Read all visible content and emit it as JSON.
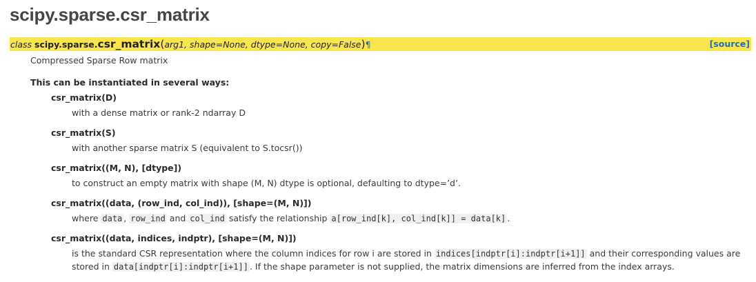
{
  "title": "scipy.sparse.csr_matrix",
  "signature": {
    "keyword": "class",
    "module": "scipy.sparse.",
    "name": "csr_matrix",
    "open": "(",
    "params": "arg1, shape=None, dtype=None, copy=False",
    "close": ")",
    "pilcrow": "¶",
    "source_link": "[source]"
  },
  "description": "Compressed Sparse Row matrix",
  "instantiation_heading": "This can be instantiated in several ways:",
  "ways": [
    {
      "term": "csr_matrix(D)",
      "text": "with a dense matrix or rank-2 ndarray D"
    },
    {
      "term": "csr_matrix(S)",
      "text": "with another sparse matrix S (equivalent to S.tocsr())"
    },
    {
      "term": "csr_matrix((M, N), [dtype])",
      "text": "to construct an empty matrix with shape (M, N) dtype is optional, defaulting to dtype=’d’."
    },
    {
      "term": "csr_matrix((data, (row_ind, col_ind)), [shape=(M, N)])",
      "parts": [
        "where ",
        "data",
        ", ",
        "row_ind",
        " and ",
        "col_ind",
        " satisfy the relationship ",
        "a[row_ind[k], col_ind[k]] = data[k]",
        "."
      ]
    },
    {
      "term": "csr_matrix((data, indices, indptr), [shape=(M, N)])",
      "line1": [
        "is the standard CSR representation where the column indices for row i are stored in ",
        "indices[indptr[i]:indptr[i+1]]",
        " and their corresponding values are"
      ],
      "line2": [
        "stored in ",
        "data[indptr[i]:indptr[i+1]]",
        ". If the shape parameter is not supplied, the matrix dimensions are inferred from the index arrays."
      ]
    }
  ]
}
